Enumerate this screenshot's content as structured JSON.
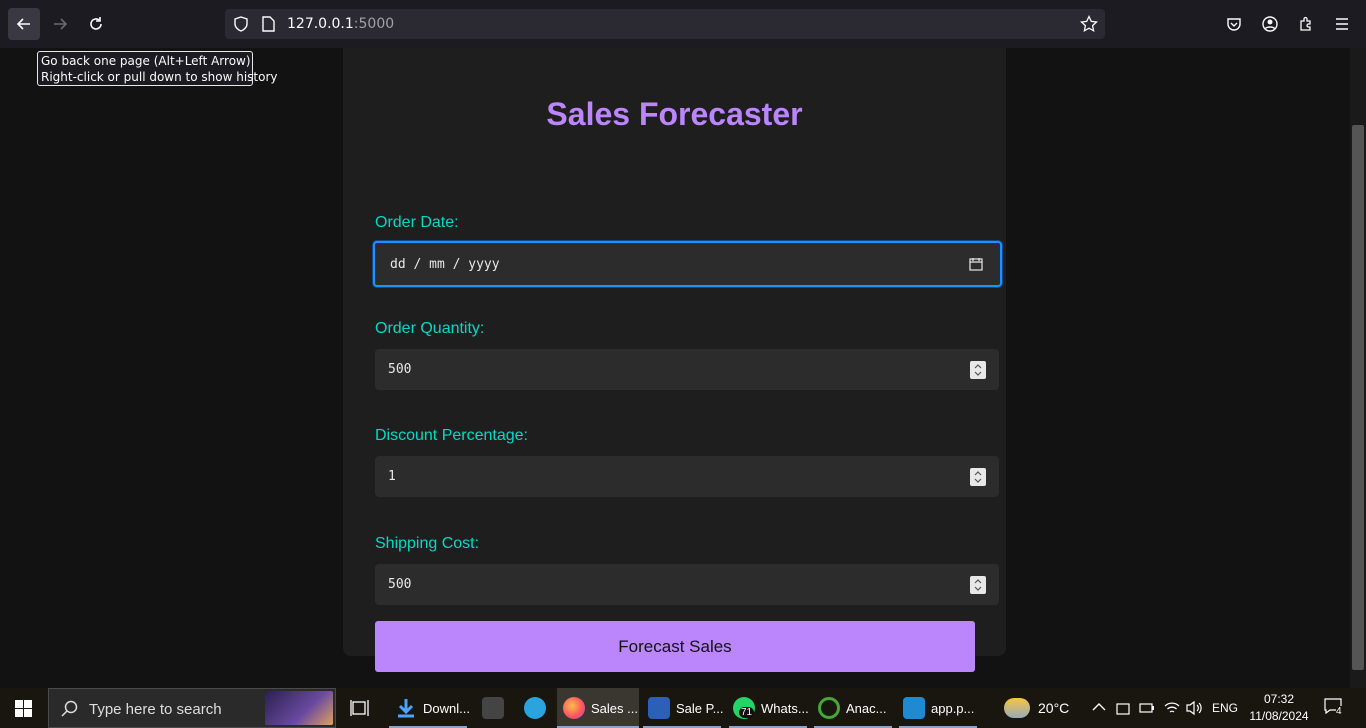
{
  "browser": {
    "url_host": "127.0.0.1",
    "url_port": ":5000",
    "tooltip_line1": "Go back one page (Alt+Left Arrow)",
    "tooltip_line2": "Right-click or pull down to show history"
  },
  "page": {
    "title": "Sales Forecaster",
    "order_date": {
      "label": "Order Date:",
      "placeholder": "dd / mm / yyyy"
    },
    "order_quantity": {
      "label": "Order Quantity:",
      "value": "500"
    },
    "discount": {
      "label": "Discount Percentage:",
      "value": "1"
    },
    "shipping": {
      "label": "Shipping Cost:",
      "value": "500"
    },
    "submit_label": "Forecast Sales"
  },
  "taskbar": {
    "search_placeholder": "Type here to search",
    "apps": [
      {
        "label": "Downl...",
        "icon": "download-icon"
      },
      {
        "label": "",
        "icon": "clapper-icon"
      },
      {
        "label": "",
        "icon": "telegram-icon"
      },
      {
        "label": "Sales ...",
        "icon": "firefox-icon"
      },
      {
        "label": "Sale P...",
        "icon": "word-icon"
      },
      {
        "label": "Whats...",
        "icon": "whatsapp-icon",
        "badge": "71"
      },
      {
        "label": "Anac...",
        "icon": "anaconda-icon"
      },
      {
        "label": "app.p...",
        "icon": "vscode-icon"
      }
    ],
    "weather": "20°C",
    "language": "ENG",
    "time": "07:32",
    "date": "11/08/2024",
    "notifications": "4"
  }
}
